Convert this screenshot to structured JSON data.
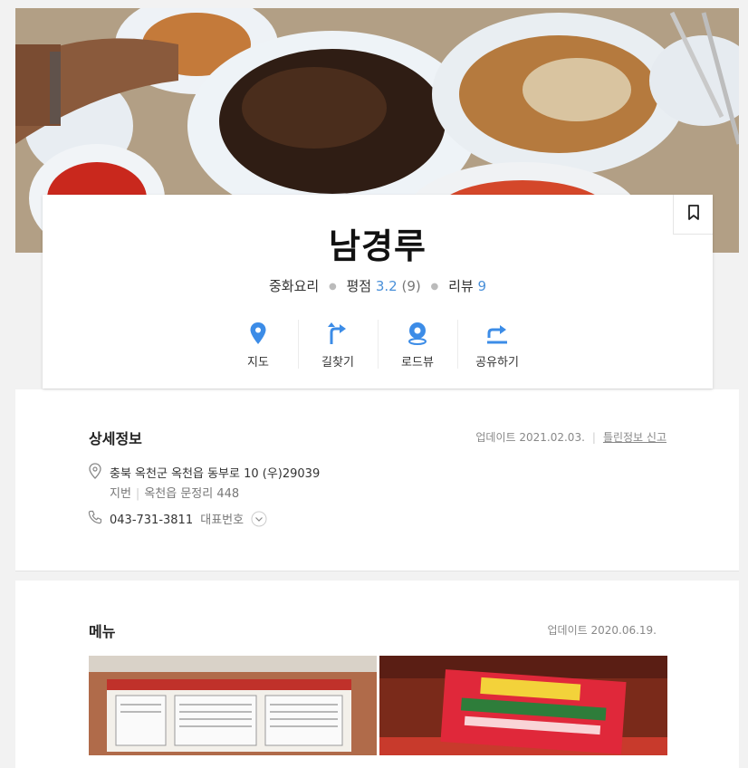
{
  "place": {
    "name": "남경루",
    "category": "중화요리",
    "rating_label": "평점",
    "rating": "3.2",
    "rating_count": "(9)",
    "review_label": "리뷰",
    "review_count": "9"
  },
  "actions": [
    {
      "label": "지도",
      "icon": "map-pin-icon"
    },
    {
      "label": "길찾기",
      "icon": "directions-icon"
    },
    {
      "label": "로드뷰",
      "icon": "roadview-icon"
    },
    {
      "label": "공유하기",
      "icon": "share-icon"
    }
  ],
  "detail": {
    "title": "상세정보",
    "updated": "업데이트 2021.02.03.",
    "report_link": "틀린정보 신고",
    "address": "충북 옥천군 옥천읍 동부로 10 (우)29039",
    "lot_label": "지번",
    "lot_address": "옥천읍 문정리 448",
    "phone": "043-731-3811",
    "phone_label": "대표번호"
  },
  "menu": {
    "title": "메뉴",
    "updated": "업데이트 2020.06.19."
  },
  "colors": {
    "accent_blue": "#4a90d9",
    "icon_blue": "#3c8ce7"
  }
}
